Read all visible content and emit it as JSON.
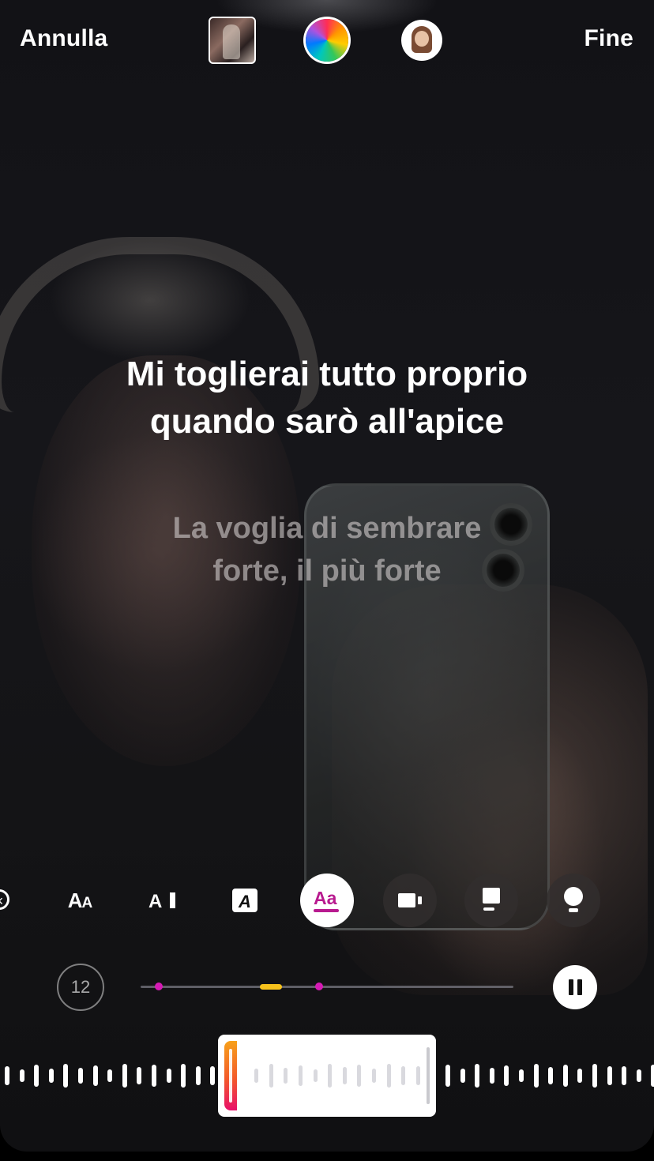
{
  "header": {
    "cancel_label": "Annulla",
    "done_label": "Fine",
    "thumbnail_icon": "photo-thumbnail-icon",
    "color_icon": "color-wheel-icon",
    "avatar_icon": "avatar-icon"
  },
  "lyrics": {
    "current": "Mi toglierai tutto proprio quando sarò all'apice",
    "next": "La voglia di sembrare forte, il più forte"
  },
  "style_bar": {
    "items": [
      {
        "name": "close-icon",
        "label": "×"
      },
      {
        "name": "text-style-caps-icon",
        "label": "AA"
      },
      {
        "name": "text-style-cursor-icon",
        "label": "A"
      },
      {
        "name": "text-style-boxed-icon",
        "label": "A"
      },
      {
        "name": "text-style-karaoke-icon",
        "label": "Aa",
        "active": true
      },
      {
        "name": "album-card-icon"
      },
      {
        "name": "music-card-icon"
      },
      {
        "name": "light-bulb-icon"
      }
    ],
    "active_color": "#b81a8f"
  },
  "player": {
    "duration_seconds": "12",
    "accent_dot_color": "#d61ab4",
    "position_color": "#f7c21c",
    "pause_icon": "pause-icon"
  },
  "waveform": {
    "handle_gradient": [
      "#f7a11a",
      "#e8106a"
    ]
  }
}
